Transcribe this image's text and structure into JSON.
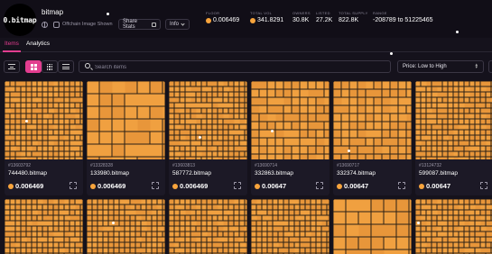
{
  "header": {
    "avatar_text": "0.bitmap",
    "collection_name": "bitmap",
    "offchain_label": "Offchain Image Shown",
    "share_stats_label": "Share Stats",
    "info_label": "Info",
    "stats": [
      {
        "label": "FLOOR",
        "value": "0.006469",
        "coin": true
      },
      {
        "label": "TOTAL VOL",
        "value": "341.8291",
        "coin": true
      },
      {
        "label": "OWNERS",
        "value": "30.8K",
        "coin": false
      },
      {
        "label": "LISTED",
        "value": "27.2K",
        "coin": false
      },
      {
        "label": "TOTAL SUPPLY",
        "value": "822.8K",
        "coin": false
      },
      {
        "label": "RANGE",
        "value": "-208789 to 51225465",
        "coin": false
      }
    ]
  },
  "tabs": [
    {
      "label": "Items",
      "active": true
    },
    {
      "label": "Analytics",
      "active": false
    }
  ],
  "toolbar": {
    "search_placeholder": "Search items",
    "sort_value": "Price: Low to High"
  },
  "cards": [
    {
      "id": "#13603792",
      "name": "744480.bitmap",
      "price": "0.006469"
    },
    {
      "id": "#13328328",
      "name": "133980.bitmap",
      "price": "0.006469"
    },
    {
      "id": "#13603813",
      "name": "587772.bitmap",
      "price": "0.006469"
    },
    {
      "id": "#13690714",
      "name": "332863.bitmap",
      "price": "0.00647"
    },
    {
      "id": "#13690717",
      "name": "332374.bitmap",
      "price": "0.00647"
    },
    {
      "id": "#13124732",
      "name": "599087.bitmap",
      "price": "0.00647"
    }
  ],
  "colors": {
    "accent": "#e23d8f",
    "coin": "#f7a43c",
    "block": "#f0a040",
    "background": "#15121c"
  }
}
